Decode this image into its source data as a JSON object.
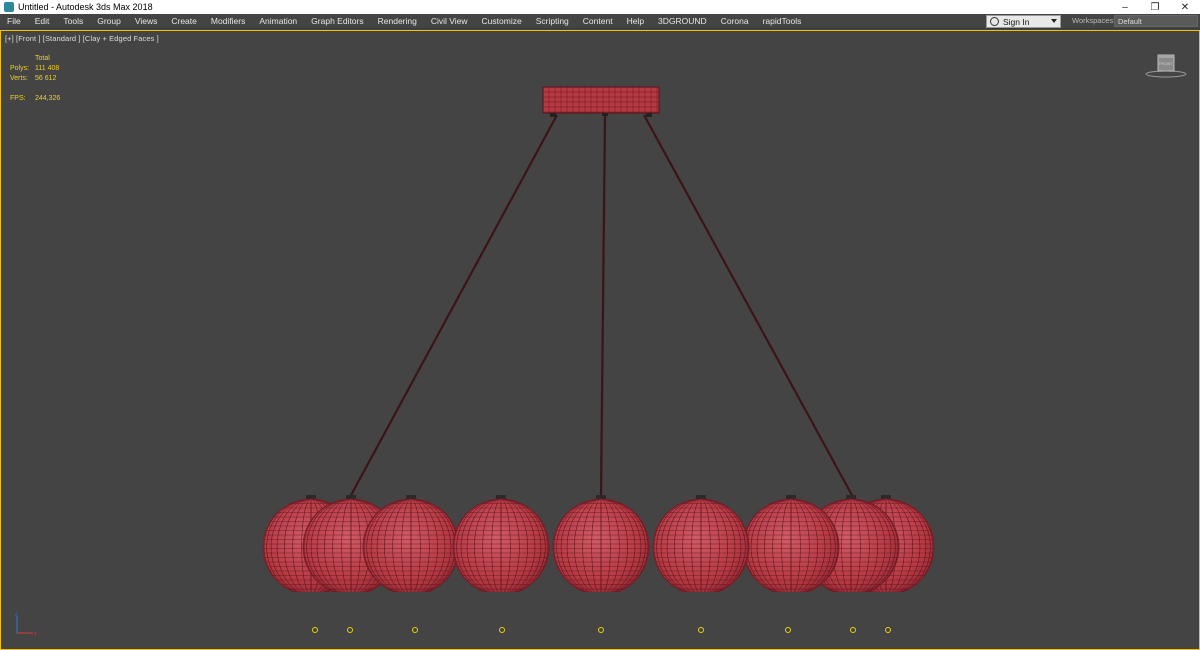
{
  "window": {
    "title": "Untitled - Autodesk 3ds Max 2018",
    "controls": [
      "minimize",
      "restore",
      "close"
    ]
  },
  "menu": {
    "items": [
      "File",
      "Edit",
      "Tools",
      "Group",
      "Views",
      "Create",
      "Modifiers",
      "Animation",
      "Graph Editors",
      "Rendering",
      "Civil View",
      "Customize",
      "Scripting",
      "Content",
      "Help",
      "3DGROUND",
      "Corona",
      "rapidTools"
    ],
    "sign_in": "Sign In",
    "workspaces_label": "Workspaces:",
    "workspace_value": "Default"
  },
  "viewport": {
    "label": "[+] [Front ] [Standard ] [Clay + Edged Faces ]",
    "stats": {
      "header": "Total",
      "polys_label": "Polys:",
      "polys_value": "111 408",
      "verts_label": "Verts:",
      "verts_value": "56 612",
      "fps_label": "FPS:",
      "fps_value": "244,326"
    },
    "viewcube_label": "FRONT"
  },
  "scene": {
    "object": "pendant-lamp",
    "shade_count": 9,
    "cable_count": 3,
    "colors": {
      "clay": "#b53a44",
      "wire": "#5a0f18",
      "background": "#444444",
      "viewport_border": "#f2c100",
      "light_marker": "#e8d400"
    }
  }
}
